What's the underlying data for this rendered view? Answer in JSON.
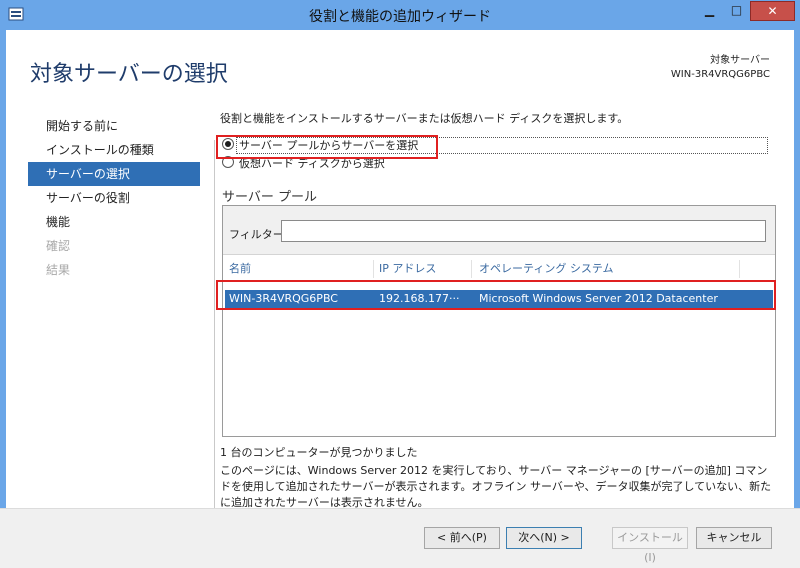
{
  "window": {
    "title": "役割と機能の追加ウィザード",
    "min_glyph": "▁",
    "max_glyph": "□",
    "close_glyph": "✕"
  },
  "header": {
    "page_title": "対象サーバーの選択",
    "target_label": "対象サーバー",
    "target_server": "WIN-3R4VRQG6PBC"
  },
  "nav": {
    "items": [
      {
        "label": "開始する前に"
      },
      {
        "label": "インストールの種類"
      },
      {
        "label": "サーバーの選択"
      },
      {
        "label": "サーバーの役割"
      },
      {
        "label": "機能"
      },
      {
        "label": "確認"
      },
      {
        "label": "結果"
      }
    ]
  },
  "main": {
    "instruction": "役割と機能をインストールするサーバーまたは仮想ハード ディスクを選択します。",
    "radio_pool": "サーバー プールからサーバーを選択",
    "radio_vhd": "仮想ハード ディスクから選択",
    "pool_title": "サーバー プール",
    "filter_label": "フィルター:",
    "filter_value": "",
    "columns": {
      "name": "名前",
      "ip": "IP アドレス",
      "os": "オペレーティング システム"
    },
    "rows": [
      {
        "name": "WIN-3R4VRQG6PBC",
        "ip": "192.168.177···",
        "os": "Microsoft Windows Server 2012 Datacenter"
      }
    ],
    "found_text": "1 台のコンピューターが見つかりました",
    "description": "このページには、Windows Server 2012 を実行しており、サーバー マネージャーの [サーバーの追加] コマンドを使用して追加されたサーバーが表示されます。オフライン サーバーや、データ収集が完了していない、新たに追加されたサーバーは表示されません。"
  },
  "footer": {
    "prev": "< 前へ(P)",
    "next": "次へ(N) >",
    "install": "インストール(I)",
    "cancel": "キャンセル"
  },
  "colors": {
    "title_bar": "#6aa6e8",
    "selection": "#2f6fb5",
    "highlight": "#e02020",
    "title_text": "#1f3c6b"
  }
}
